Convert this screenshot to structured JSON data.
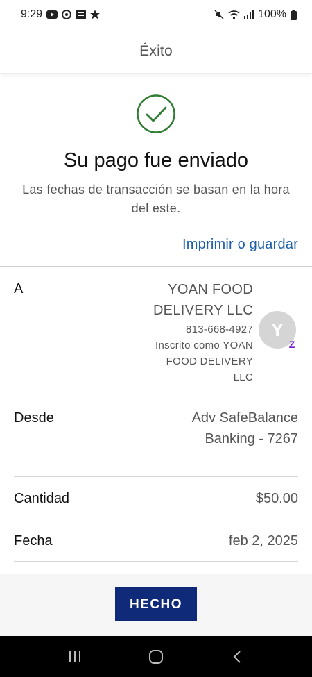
{
  "status_bar": {
    "time": "9:29",
    "battery": "100%"
  },
  "header": {
    "title": "Éxito"
  },
  "confirmation": {
    "headline": "Su pago fue enviado",
    "subtext": "Las fechas de transacción se basan en la hora del este.",
    "print_link": "Imprimir o guardar"
  },
  "details": {
    "to": {
      "label": "A",
      "name_line1": "YOAN FOOD",
      "name_line2": "DELIVERY LLC",
      "phone": "813-668-4927",
      "enrolled_line1": "Inscrito como YOAN",
      "enrolled_line2": "FOOD DELIVERY",
      "enrolled_line3": "LLC",
      "avatar_initial": "Y",
      "badge_glyph": "Z"
    },
    "from": {
      "label": "Desde",
      "value_line1": "Adv SafeBalance",
      "value_line2": "Banking - 7267"
    },
    "amount": {
      "label": "Cantidad",
      "value": "$50.00"
    },
    "date": {
      "label": "Fecha",
      "value": "feb 2, 2025"
    }
  },
  "actions": {
    "done_label": "HECHO"
  },
  "colors": {
    "accent_link": "#1d5fa8",
    "button_bg": "#0e2a78",
    "success_green": "#2e7d32",
    "zelle_purple": "#6d1ed4"
  }
}
